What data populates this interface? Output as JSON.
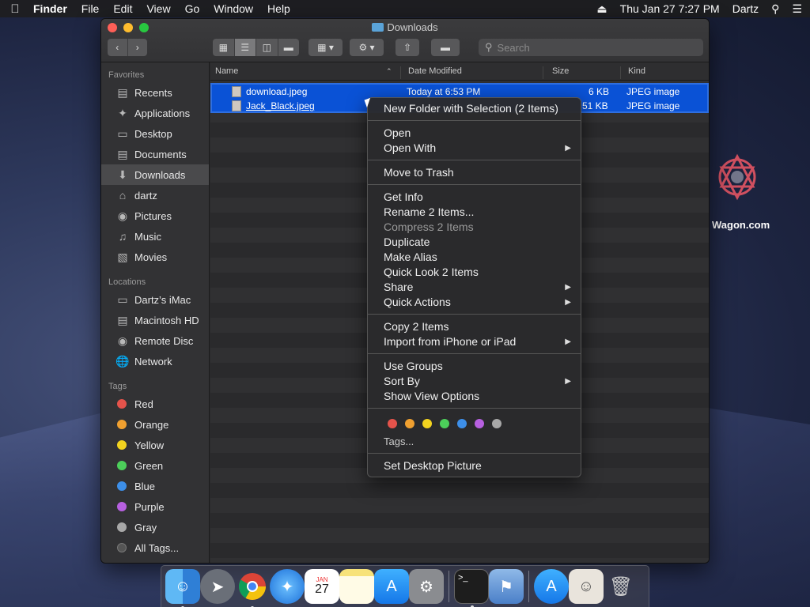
{
  "menubar": {
    "app": "Finder",
    "items": [
      "File",
      "Edit",
      "View",
      "Go",
      "Window",
      "Help"
    ],
    "datetime": "Thu Jan 27  7:27 PM",
    "user": "Dartz"
  },
  "desktop": {
    "icon_label": "Wagon.com"
  },
  "window": {
    "title": "Downloads",
    "search_placeholder": "Search"
  },
  "sidebar": {
    "favorites_title": "Favorites",
    "favorites": [
      {
        "label": "Recents",
        "icon": "recents-icon"
      },
      {
        "label": "Applications",
        "icon": "applications-icon"
      },
      {
        "label": "Desktop",
        "icon": "desktop-icon"
      },
      {
        "label": "Documents",
        "icon": "documents-icon"
      },
      {
        "label": "Downloads",
        "icon": "downloads-icon"
      },
      {
        "label": "dartz",
        "icon": "home-icon"
      },
      {
        "label": "Pictures",
        "icon": "pictures-icon"
      },
      {
        "label": "Music",
        "icon": "music-icon"
      },
      {
        "label": "Movies",
        "icon": "movies-icon"
      }
    ],
    "locations_title": "Locations",
    "locations": [
      {
        "label": "Dartz’s iMac"
      },
      {
        "label": "Macintosh HD"
      },
      {
        "label": "Remote Disc"
      },
      {
        "label": "Network"
      }
    ],
    "tags_title": "Tags",
    "tags": [
      {
        "label": "Red",
        "color": "#e5534b"
      },
      {
        "label": "Orange",
        "color": "#f0a030"
      },
      {
        "label": "Yellow",
        "color": "#f2d31f"
      },
      {
        "label": "Green",
        "color": "#4ccf5a"
      },
      {
        "label": "Blue",
        "color": "#3d8fe8"
      },
      {
        "label": "Purple",
        "color": "#b760e0"
      },
      {
        "label": "Gray",
        "color": "#a8a8a8"
      },
      {
        "label": "All Tags...",
        "color": "#555555"
      }
    ]
  },
  "list": {
    "headers": {
      "name": "Name",
      "date": "Date Modified",
      "size": "Size",
      "kind": "Kind"
    },
    "rows": [
      {
        "name": "download.jpeg",
        "date": "Today at 6:53 PM",
        "size": "6 KB",
        "kind": "JPEG image"
      },
      {
        "name": "Jack_Black.jpeg",
        "date": "",
        "size": "51 KB",
        "kind": "JPEG image"
      }
    ]
  },
  "context_menu": {
    "new_folder": "New Folder with Selection (2 Items)",
    "open": "Open",
    "open_with": "Open With",
    "move_to_trash": "Move to Trash",
    "get_info": "Get Info",
    "rename": "Rename 2 Items...",
    "compress": "Compress 2 Items",
    "duplicate": "Duplicate",
    "make_alias": "Make Alias",
    "quick_look": "Quick Look 2 Items",
    "share": "Share",
    "quick_actions": "Quick Actions",
    "copy": "Copy 2 Items",
    "import": "Import from iPhone or iPad",
    "use_groups": "Use Groups",
    "sort_by": "Sort By",
    "show_view_options": "Show View Options",
    "tag_colors": [
      "#e5534b",
      "#f0a030",
      "#f2d31f",
      "#4ccf5a",
      "#3d8fe8",
      "#b760e0",
      "#a8a8a8"
    ],
    "tags": "Tags...",
    "set_desktop": "Set Desktop Picture"
  },
  "dock": {
    "items": [
      "finder",
      "launchpad",
      "chrome",
      "safari",
      "calendar",
      "notes",
      "app-store",
      "system-preferences",
      "terminal",
      "preview",
      "app-store-downloads",
      "photo",
      "trash"
    ],
    "calendar": {
      "month": "JAN",
      "day": "27"
    }
  }
}
